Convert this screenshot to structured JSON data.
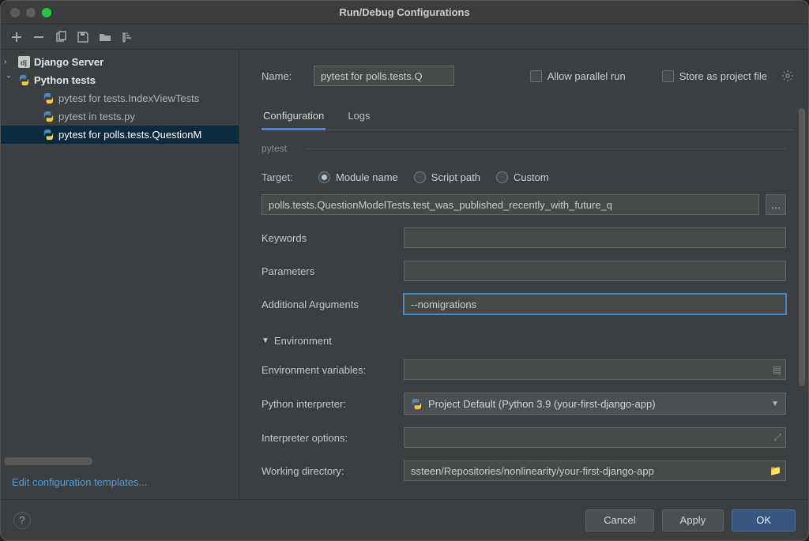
{
  "window": {
    "title": "Run/Debug Configurations"
  },
  "sidebar": {
    "items": [
      {
        "label": "Django Server",
        "expanded": false,
        "icon": "django"
      },
      {
        "label": "Python tests",
        "expanded": true,
        "icon": "python"
      }
    ],
    "children": [
      {
        "label": "pytest for tests.IndexViewTests"
      },
      {
        "label": "pytest in tests.py"
      },
      {
        "label": "pytest for polls.tests.QuestionM"
      }
    ],
    "footer_link": "Edit configuration templates..."
  },
  "form": {
    "name_label": "Name:",
    "name_value": "pytest for polls.tests.Q",
    "allow_parallel": "Allow parallel run",
    "store_project": "Store as project file",
    "tabs": {
      "config": "Configuration",
      "logs": "Logs"
    },
    "section_pytest": "pytest",
    "target_label": "Target:",
    "target_options": {
      "module": "Module name",
      "script": "Script path",
      "custom": "Custom"
    },
    "target_value": "polls.tests.QuestionModelTests.test_was_published_recently_with_future_q",
    "keywords_label": "Keywords",
    "keywords_value": "",
    "parameters_label": "Parameters",
    "parameters_value": "",
    "addargs_label": "Additional Arguments",
    "addargs_value": "--nomigrations",
    "env_header": "Environment",
    "envvars_label": "Environment variables:",
    "envvars_value": "",
    "interpreter_label": "Python interpreter:",
    "interpreter_value": "Project Default (Python 3.9 (your-first-django-app)",
    "intopts_label": "Interpreter options:",
    "intopts_value": "",
    "workdir_label": "Working directory:",
    "workdir_value": "ssteen/Repositories/nonlinearity/your-first-django-app"
  },
  "footer": {
    "cancel": "Cancel",
    "apply": "Apply",
    "ok": "OK"
  }
}
